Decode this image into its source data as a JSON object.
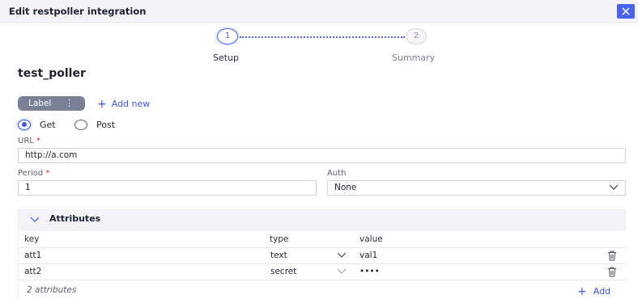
{
  "dialog": {
    "title": "Edit restpoller integration"
  },
  "stepper": {
    "steps": [
      {
        "number": "1",
        "label": "Setup"
      },
      {
        "number": "2",
        "label": "Summary"
      }
    ]
  },
  "poller_name": "test_poller",
  "labels": {
    "chip_text": "Label",
    "add_new": "Add new"
  },
  "method": {
    "options": [
      "Get",
      "Post"
    ],
    "selected": "Get"
  },
  "url": {
    "label": "URL",
    "required_mark": "*",
    "value": "http://a.com"
  },
  "period": {
    "label": "Period",
    "required_mark": "*",
    "value": "1"
  },
  "auth": {
    "label": "Auth",
    "value": "None"
  },
  "attributes": {
    "title": "Attributes",
    "columns": [
      "key",
      "type",
      "value"
    ],
    "rows": [
      {
        "key": "att1",
        "type": "text",
        "value": "val1"
      },
      {
        "key": "att2",
        "type": "secret",
        "value": "••••"
      }
    ],
    "count_text": "2 attributes",
    "add_label": "Add"
  },
  "colors": {
    "accent": "#3b57e6",
    "close_button": "#4a63f0",
    "chip": "#7a8196"
  },
  "icons": {
    "close": "close-icon",
    "kebab": "kebab-icon",
    "plus": "plus-icon",
    "chevron": "chevron-down-icon",
    "trash": "trash-icon"
  }
}
